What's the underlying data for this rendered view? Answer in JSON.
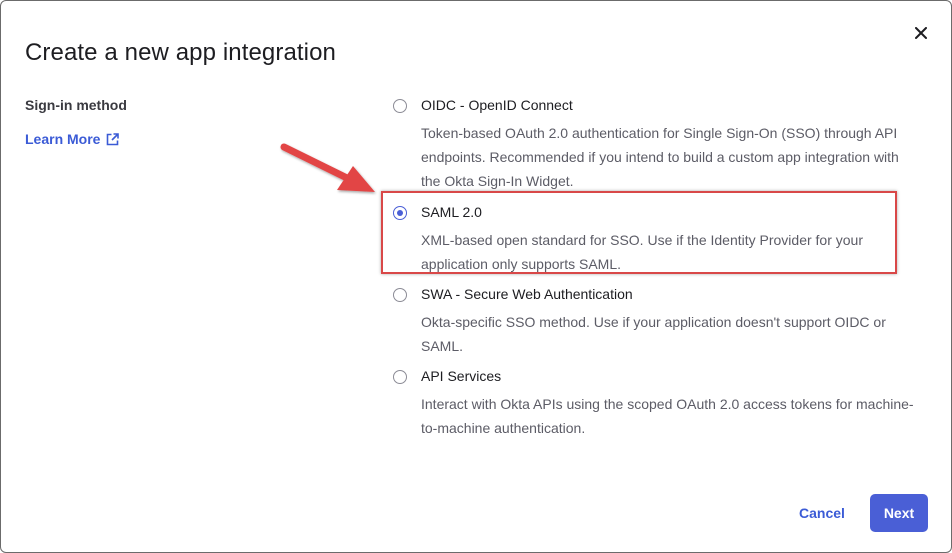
{
  "dialog": {
    "title": "Create a new app integration",
    "close_icon": "close-icon"
  },
  "sidebar": {
    "section_label": "Sign-in method",
    "learn_more": "Learn More",
    "learn_more_icon": "external-link-icon"
  },
  "options": [
    {
      "title": "OIDC - OpenID Connect",
      "description": "Token-based OAuth 2.0 authentication for Single Sign-On (SSO) through API endpoints. Recommended if you intend to build a custom app integration with the Okta Sign-In Widget.",
      "selected": false
    },
    {
      "title": "SAML 2.0",
      "description": "XML-based open standard for SSO. Use if the Identity Provider for your application only supports SAML.",
      "selected": true
    },
    {
      "title": "SWA - Secure Web Authentication",
      "description": "Okta-specific SSO method. Use if your application doesn't support OIDC or SAML.",
      "selected": false
    },
    {
      "title": "API Services",
      "description": "Interact with Okta APIs using the scoped OAuth 2.0 access tokens for machine-to-machine authentication.",
      "selected": false
    }
  ],
  "footer": {
    "cancel_label": "Cancel",
    "next_label": "Next"
  },
  "colors": {
    "accent": "#4a5fd6",
    "link": "#3b5bd6",
    "annotation": "#d94848"
  }
}
